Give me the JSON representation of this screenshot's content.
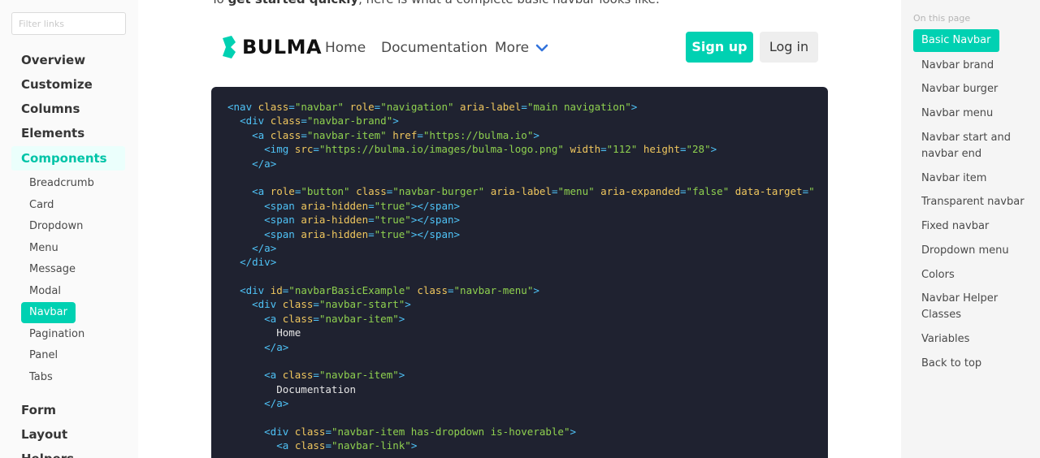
{
  "sidebar": {
    "filter_placeholder": "Filter links",
    "categories": {
      "overview": "Overview",
      "customize": "Customize",
      "columns": "Columns",
      "elements": "Elements",
      "components": "Components",
      "form": "Form",
      "layout": "Layout",
      "helpers": "Helpers"
    },
    "components_items": [
      "Breadcrumb",
      "Card",
      "Dropdown",
      "Menu",
      "Message",
      "Modal",
      "Navbar",
      "Pagination",
      "Panel",
      "Tabs"
    ],
    "active_item": "Navbar"
  },
  "main": {
    "intro_prefix": "To ",
    "intro_bold": "get started quickly",
    "intro_suffix": ", here is what a complete basic navbar looks like:",
    "navbar_demo": {
      "brand": "BULMA",
      "links": [
        "Home",
        "Documentation",
        "More"
      ],
      "signup": "Sign up",
      "login": "Log in",
      "brand_color": "#00d1b2"
    },
    "code_lines": [
      "<nav class=\"navbar\" role=\"navigation\" aria-label=\"main navigation\">",
      "  <div class=\"navbar-brand\">",
      "    <a class=\"navbar-item\" href=\"https://bulma.io\">",
      "      <img src=\"https://bulma.io/images/bulma-logo.png\" width=\"112\" height=\"28\">",
      "    </a>",
      "",
      "    <a role=\"button\" class=\"navbar-burger\" aria-label=\"menu\" aria-expanded=\"false\" data-target=\"",
      "      <span aria-hidden=\"true\"></span>",
      "      <span aria-hidden=\"true\"></span>",
      "      <span aria-hidden=\"true\"></span>",
      "    </a>",
      "  </div>",
      "",
      "  <div id=\"navbarBasicExample\" class=\"navbar-menu\">",
      "    <div class=\"navbar-start\">",
      "      <a class=\"navbar-item\">",
      "        Home",
      "      </a>",
      "",
      "      <a class=\"navbar-item\">",
      "        Documentation",
      "      </a>",
      "",
      "      <div class=\"navbar-item has-dropdown is-hoverable\">",
      "        <a class=\"navbar-link\">"
    ]
  },
  "toc": {
    "title": "On this page",
    "items": [
      "Basic Navbar",
      "Navbar brand",
      "Navbar burger",
      "Navbar menu",
      "Navbar start and navbar end",
      "Navbar item",
      "Transparent navbar",
      "Fixed navbar",
      "Dropdown menu",
      "Colors",
      "Navbar Helper Classes",
      "Variables",
      "Back to top"
    ],
    "active": "Basic Navbar"
  },
  "colors": {
    "accent": "#00d1b2",
    "code_bg": "#1f2230"
  }
}
